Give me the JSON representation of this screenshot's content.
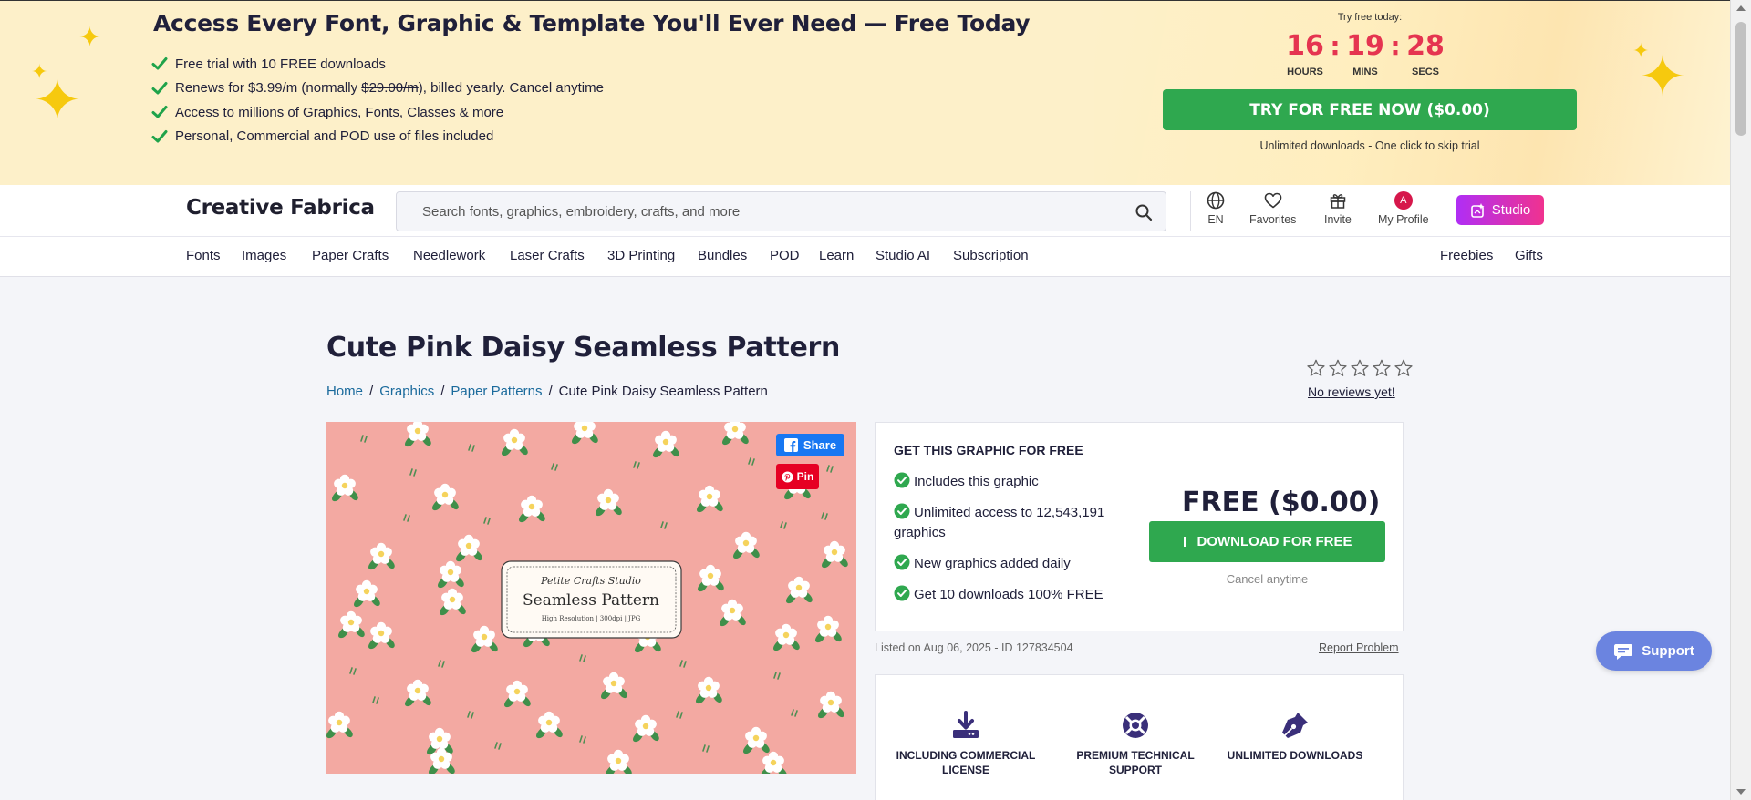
{
  "promo": {
    "title": "Access Every Font, Graphic & Template You'll Ever Need — Free Today",
    "bullets": [
      {
        "text": "Free trial with 10 FREE downloads"
      },
      {
        "pre": "Renews for $3.99/m (normally ",
        "strike": "$29.00/m",
        "post": "), billed yearly. Cancel anytime"
      },
      {
        "text": "Access to millions of Graphics, Fonts, Classes & more"
      },
      {
        "text": "Personal, Commercial and POD use of files included"
      }
    ],
    "timer_label": "Try free today:",
    "timer": {
      "hours": "16",
      "hours_label": "HOURS",
      "mins": "19",
      "mins_label": "MINS",
      "secs": "28",
      "secs_label": "SECS",
      "separator": ":"
    },
    "cta_label": "TRY FOR FREE NOW ($0.00)",
    "cta_sub": "Unlimited downloads - One click to skip trial",
    "accent_color": "#2fa84f",
    "timer_color": "#e53450"
  },
  "header": {
    "logo": "Creative Fabrica",
    "search_placeholder": "Search fonts, graphics, embroidery, crafts, and more",
    "language": "EN",
    "favorites": "Favorites",
    "invite": "Invite",
    "profile": "My Profile",
    "avatar_letter": "A",
    "studio": "Studio"
  },
  "nav": {
    "left": [
      "Fonts",
      "Images",
      "Paper Crafts",
      "Needlework",
      "Laser Crafts",
      "3D Printing",
      "Bundles",
      "POD",
      "Learn",
      "Studio AI",
      "Subscription"
    ],
    "right": [
      "Freebies",
      "Gifts"
    ]
  },
  "product": {
    "title": "Cute Pink Daisy Seamless Pattern",
    "breadcrumb": [
      "Home",
      "Graphics",
      "Paper Patterns",
      "Cute Pink Daisy Seamless Pattern"
    ],
    "breadcrumb_sep": "/",
    "rating": 0,
    "rating_max": 5,
    "no_reviews": "No reviews yet!",
    "image_card": {
      "script": "Petite Crafts Studio",
      "title": "Seamless Pattern",
      "sub": "High Resolution | 300dpi | JPG"
    },
    "share": "Share",
    "pin": "Pin",
    "listed": "Listed on Aug 06, 2025 - ID 127834504",
    "report": "Report Problem"
  },
  "offer": {
    "heading": "GET THIS GRAPHIC FOR FREE",
    "items": [
      "Includes this graphic",
      "Unlimited access to 12,543,191 graphics",
      "New graphics added daily",
      "Get 10 downloads 100% FREE"
    ],
    "price": "FREE ($0.00)",
    "download_label": "DOWNLOAD FOR FREE",
    "cancel": "Cancel anytime"
  },
  "features": [
    {
      "icon": "download-tray-icon",
      "label": "INCLUDING COMMERCIAL LICENSE"
    },
    {
      "icon": "lifebuoy-icon",
      "label": "PREMIUM TECHNICAL SUPPORT"
    },
    {
      "icon": "pen-nib-icon",
      "label": "UNLIMITED DOWNLOADS"
    }
  ],
  "support": "Support"
}
